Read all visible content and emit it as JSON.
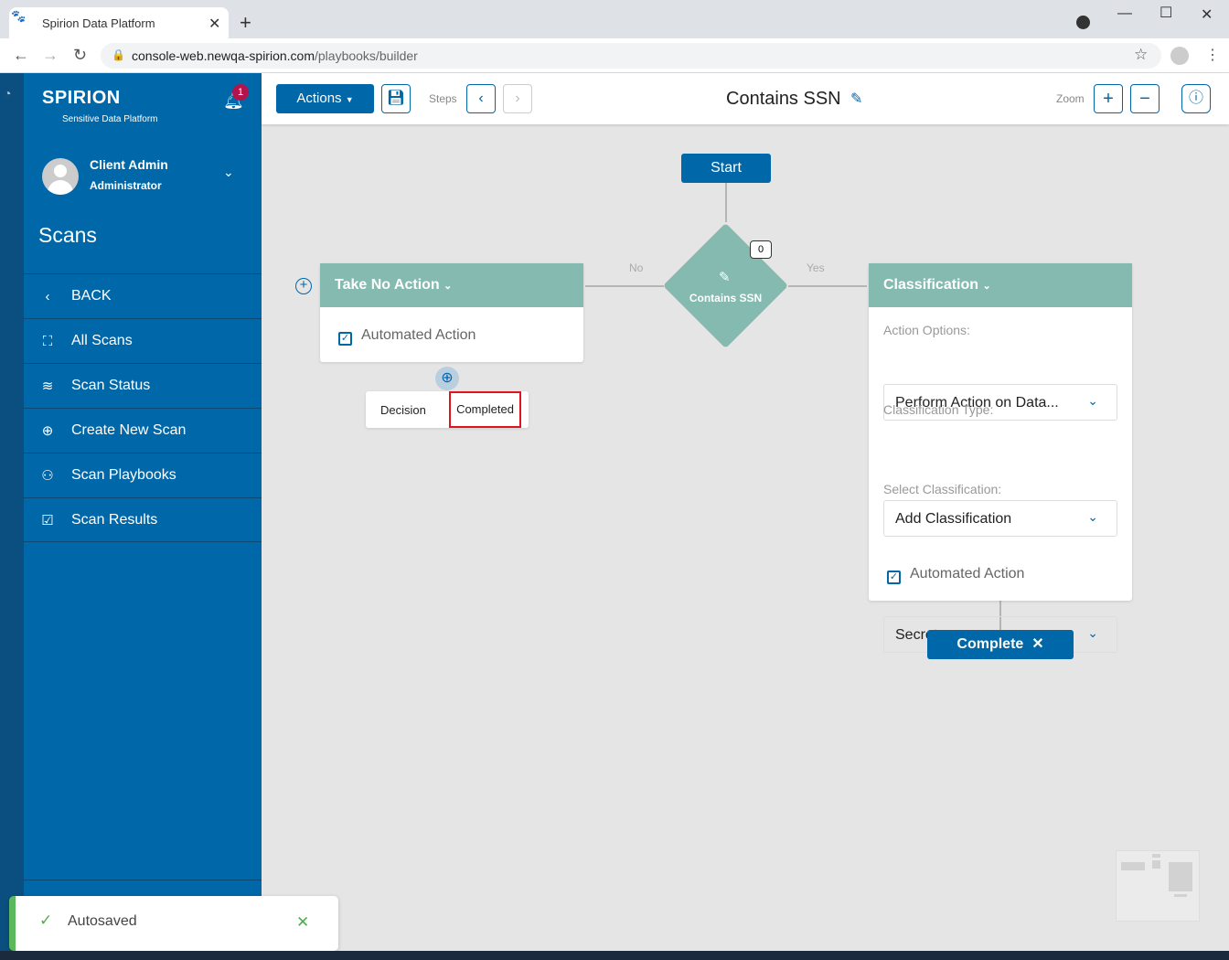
{
  "browser": {
    "tab_title": "Spirion Data Platform",
    "url_domain": "console-web.newqa-spirion.com",
    "url_path": "/playbooks/builder"
  },
  "sidebar": {
    "logo": "SPIRION",
    "logo_sub": "Sensitive Data Platform",
    "notifications": "1",
    "user_name": "Client Admin",
    "user_role": "Administrator",
    "section": "Scans",
    "items": [
      {
        "label": "BACK",
        "icon": "‹"
      },
      {
        "label": "All Scans",
        "icon": "⛶"
      },
      {
        "label": "Scan Status",
        "icon": "≋"
      },
      {
        "label": "Create New Scan",
        "icon": "⊕"
      },
      {
        "label": "Scan Playbooks",
        "icon": "⚇"
      },
      {
        "label": "Scan Results",
        "icon": "☑"
      }
    ]
  },
  "toolbar": {
    "actions": "Actions",
    "steps": "Steps",
    "title": "Contains SSN",
    "zoom": "Zoom"
  },
  "flow": {
    "start": "Start",
    "decision": "Contains SSN",
    "decision_count": "0",
    "no": "No",
    "yes": "Yes",
    "left_card": {
      "title": "Take No Action",
      "automated": "Automated Action"
    },
    "popup": {
      "decision": "Decision",
      "completed": "Completed"
    },
    "right_card": {
      "title": "Classification",
      "action_options_label": "Action Options:",
      "action_options": "Perform Action on Data...",
      "class_type_label": "Classification Type:",
      "class_type": "Add Classification",
      "select_class_label": "Select Classification:",
      "select_class": "Secret",
      "automated": "Automated Action"
    },
    "complete": "Complete"
  },
  "toast": {
    "message": "Autosaved"
  },
  "colors": {
    "primary": "#0067a8",
    "card_header": "#84bab0",
    "highlight": "#e0141e",
    "success": "#4caf50"
  }
}
